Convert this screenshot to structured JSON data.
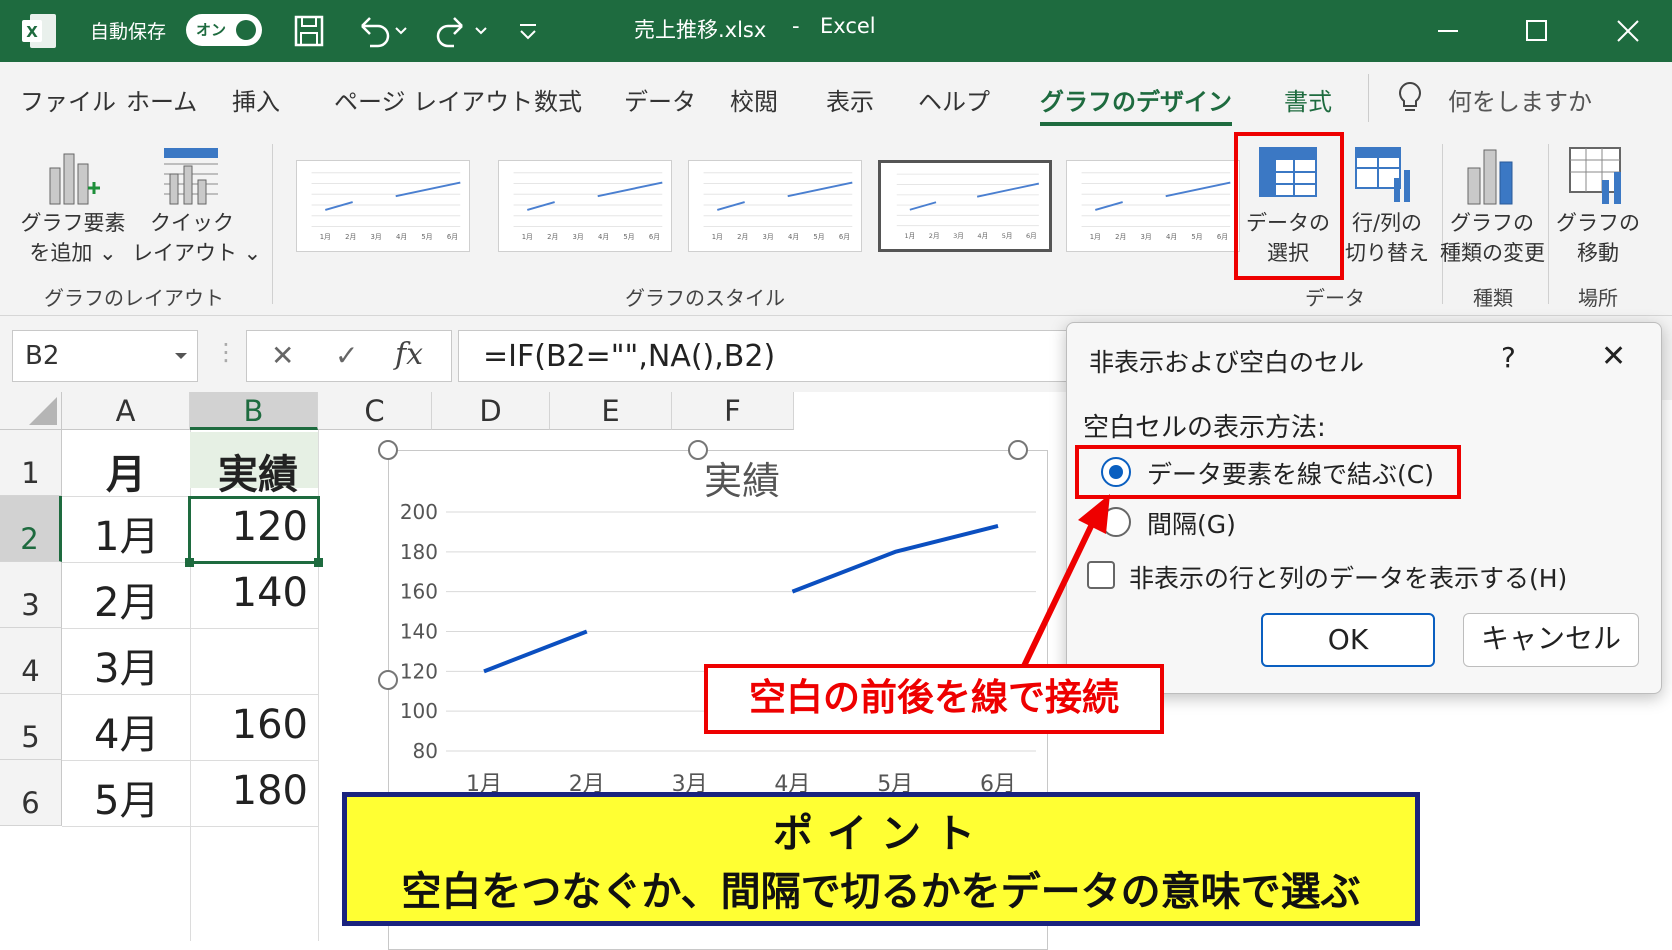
{
  "titlebar": {
    "autosave_label": "自動保存",
    "autosave_state": "オン",
    "filename": "売上推移.xlsx",
    "sep": "-",
    "app": "Excel"
  },
  "menu": {
    "tabs": [
      "ファイル",
      "ホーム",
      "挿入",
      "ページ レイアウト",
      "数式",
      "データ",
      "校閲",
      "表示",
      "ヘルプ",
      "グラフのデザイン",
      "書式"
    ],
    "active_tab": "グラフのデザイン",
    "search_placeholder": "何をしますか"
  },
  "ribbon": {
    "add_element": [
      "グラフ要素",
      "を追加 ⌄"
    ],
    "quick_layout": [
      "クイック",
      "レイアウト ⌄"
    ],
    "group_layout": "グラフのレイアウト",
    "group_styles": "グラフのスタイル",
    "select_data": [
      "データの",
      "選択"
    ],
    "switch_rowcol": [
      "行/列の",
      "切り替え"
    ],
    "change_type": [
      "グラフの",
      "種類の変更"
    ],
    "move_chart": [
      "グラフの",
      "移動"
    ],
    "group_data": "データ",
    "group_type": "種類",
    "group_location": "場所",
    "thumb_axis": [
      "1月",
      "2月",
      "3月",
      "4月",
      "5月",
      "6月"
    ]
  },
  "formula_bar": {
    "name_box": "B2",
    "cancel": "✕",
    "enter": "✓",
    "fx": "fx",
    "formula": "=IF(B2=\"\",NA(),B2)"
  },
  "sheet": {
    "columns": [
      "A",
      "B",
      "C",
      "D",
      "E",
      "F"
    ],
    "rows": [
      "1",
      "2",
      "3",
      "4",
      "5",
      "6"
    ],
    "header_a": "月",
    "header_b": "実績",
    "data": [
      {
        "month": "1月",
        "value": "120"
      },
      {
        "month": "2月",
        "value": "140"
      },
      {
        "month": "3月",
        "value": ""
      },
      {
        "month": "4月",
        "value": "160"
      },
      {
        "month": "5月",
        "value": "180"
      }
    ],
    "selected_cell": "B2"
  },
  "chart_data": {
    "type": "line",
    "title": "実績",
    "categories": [
      "1月",
      "2月",
      "3月",
      "4月",
      "5月",
      "6月"
    ],
    "series": [
      {
        "values": [
          120,
          140,
          null,
          160,
          180,
          193
        ]
      }
    ],
    "ylim": [
      80,
      200
    ],
    "yticks": [
      "200",
      "180",
      "160",
      "140",
      "120",
      "100",
      "80"
    ],
    "grid": true,
    "line_color": "#0b4fc0"
  },
  "dialog": {
    "title": "非表示および空白のセル",
    "help": "?",
    "close": "✕",
    "section_label": "空白セルの表示方法:",
    "option_connect": "データ要素を線で結ぶ(C)",
    "option_gap": "間隔(G)",
    "checkbox_hidden": "非表示の行と列のデータを表示する(H)",
    "ok": "OK",
    "cancel": "キャンセル"
  },
  "annotations": {
    "callout": "空白の前後を線で接続",
    "point_title": "ポイント",
    "point_text": "空白をつなぐか、間隔で切るかをデータの意味で選ぶ"
  },
  "colors": {
    "excel_green": "#1e6b3f",
    "highlight_red": "#e00000",
    "point_yellow": "#ffff33",
    "point_border": "#1a237e",
    "radio_blue": "#0a5fc0"
  }
}
